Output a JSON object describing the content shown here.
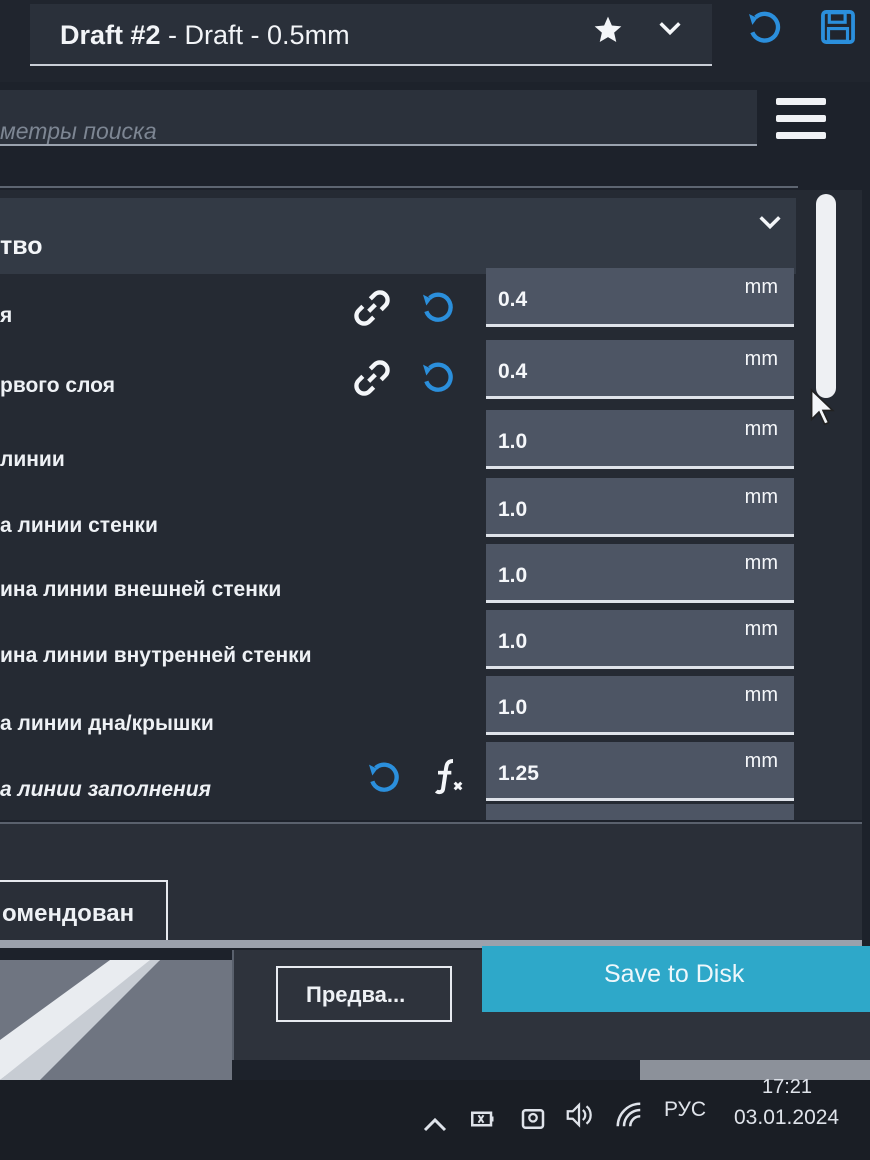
{
  "header": {
    "profile_name": "Draft #2",
    "profile_rest": " - Draft - 0.5mm",
    "icons": [
      "star-icon",
      "chevron-down-icon",
      "undo-icon",
      "save-icon"
    ]
  },
  "search": {
    "placeholder": "метры поиска"
  },
  "category": {
    "title": "тво"
  },
  "settings": [
    {
      "label": "я",
      "value": "0.4",
      "unit": "mm"
    },
    {
      "label": "рвого слоя",
      "value": "0.4",
      "unit": "mm"
    },
    {
      "label": "линии",
      "value": "1.0",
      "unit": "mm"
    },
    {
      "label": "а линии стенки",
      "value": "1.0",
      "unit": "mm"
    },
    {
      "label": "ина линии внешней стенки",
      "value": "1.0",
      "unit": "mm"
    },
    {
      "label": "ина линии внутренней стенки",
      "value": "1.0",
      "unit": "mm"
    },
    {
      "label": "а линии дна/крышки",
      "value": "1.0",
      "unit": "mm"
    },
    {
      "label": "а линии заполнения",
      "value": "1.25",
      "unit": "mm"
    }
  ],
  "footer": {
    "recommended_label": "омендован",
    "preview_label": "Предва...",
    "save_label": "Save to Disk"
  },
  "taskbar": {
    "language": "РУС",
    "time": "17:21",
    "date": "03.01.2024"
  },
  "colors": {
    "accent_blue": "#2b8fdc",
    "save_button": "#2ea8c9",
    "panel": "#252a33",
    "field": "#4d5564"
  }
}
